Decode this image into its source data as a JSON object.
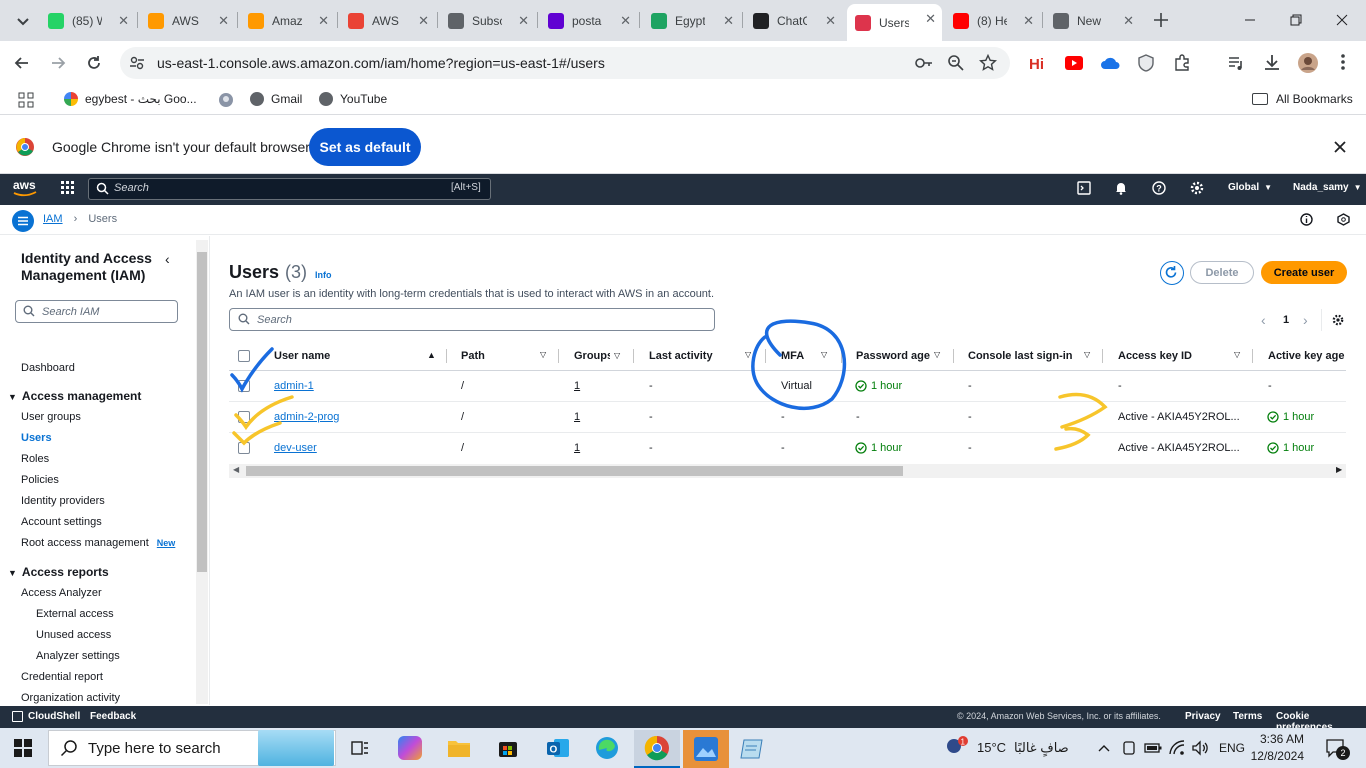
{
  "browser": {
    "tabs": [
      {
        "label": "(85) W",
        "color": "#25d366"
      },
      {
        "label": "AWS",
        "color": "#ff9900"
      },
      {
        "label": "Amaz",
        "color": "#ff9900"
      },
      {
        "label": "AWS",
        "color": "#ea4335"
      },
      {
        "label": "Subsc",
        "color": "#5f6368"
      },
      {
        "label": "posta",
        "color": "#6001d2"
      },
      {
        "label": "Egypt",
        "color": "#1ea362"
      },
      {
        "label": "ChatG",
        "color": "#202124"
      },
      {
        "label": "Users",
        "color": "#dd344c",
        "active": true
      },
      {
        "label": "(8) He",
        "color": "#ff0000"
      },
      {
        "label": "New",
        "color": "#5f6368"
      }
    ],
    "url": "us-east-1.console.aws.amazon.com/iam/home?region=us-east-1#/users",
    "bookmarks": [
      "egybest - بحث Goo...",
      "Gmail",
      "YouTube"
    ],
    "all_bookmarks": "All Bookmarks",
    "infobar_text": "Google Chrome isn't your default browser",
    "set_default": "Set as default"
  },
  "aws_header": {
    "logo": "aws",
    "search_placeholder": "Search",
    "search_shortcut": "[Alt+S]",
    "region": "Global",
    "account": "Nada_samy"
  },
  "breadcrumb": {
    "root": "IAM",
    "current": "Users"
  },
  "sidenav": {
    "title": "Identity and Access Management (IAM)",
    "search_placeholder": "Search IAM",
    "dashboard": "Dashboard",
    "access_management": "Access management",
    "am_items": [
      "User groups",
      "Users",
      "Roles",
      "Policies",
      "Identity providers",
      "Account settings",
      "Root access management"
    ],
    "new_badge": "New",
    "access_reports": "Access reports",
    "ar_items": [
      "Access Analyzer",
      "External access",
      "Unused access",
      "Analyzer settings",
      "Credential report",
      "Organization activity"
    ]
  },
  "main": {
    "title": "Users",
    "count": "(3)",
    "info": "Info",
    "description": "An IAM user is an identity with long-term credentials that is used to interact with AWS in an account.",
    "search_placeholder": "Search",
    "delete": "Delete",
    "create": "Create user",
    "page": "1",
    "columns": [
      "User name",
      "Path",
      "Groups",
      "Last activity",
      "MFA",
      "Password age",
      "Console last sign-in",
      "Access key ID",
      "Active key age"
    ],
    "rows": [
      {
        "name": "admin-1",
        "path": "/",
        "groups": "1",
        "last_activity": "-",
        "mfa": "Virtual",
        "password_age": "1 hour",
        "console": "-",
        "access_key": "-",
        "key_age": "-"
      },
      {
        "name": "admin-2-prog",
        "path": "/",
        "groups": "1",
        "last_activity": "-",
        "mfa": "-",
        "password_age": "-",
        "console": "-",
        "access_key": "Active - AKIA45Y2ROL...",
        "key_age": "1 hour"
      },
      {
        "name": "dev-user",
        "path": "/",
        "groups": "1",
        "last_activity": "-",
        "mfa": "-",
        "password_age": "1 hour",
        "console": "-",
        "access_key": "Active - AKIA45Y2ROL...",
        "key_age": "1 hour"
      }
    ]
  },
  "footer": {
    "cloudshell": "CloudShell",
    "feedback": "Feedback",
    "copyright": "© 2024, Amazon Web Services, Inc. or its affiliates.",
    "privacy": "Privacy",
    "terms": "Terms",
    "cookies": "Cookie preferences"
  },
  "taskbar": {
    "search_placeholder": "Type here to search",
    "weather": "15°C",
    "weather_text": "صافٍ غالبًا",
    "lang": "ENG",
    "time": "3:36 AM",
    "date": "12/8/2024",
    "notifications": "2"
  }
}
